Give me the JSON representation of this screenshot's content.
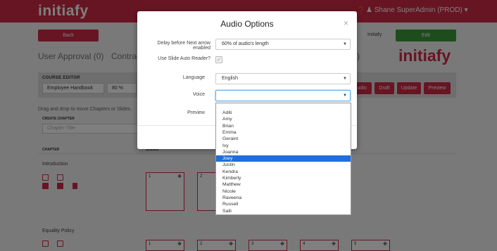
{
  "app": {
    "brand": "initiafy",
    "help_icon": "question-circle-icon",
    "user_label": "Shane SuperAdmin (PROD)",
    "user_icon": "user-icon",
    "back_label": "Back",
    "tab_user_approval": "User Approval (0)",
    "tab_contract": "Contrac",
    "tab_right": ")",
    "initiafy_link": "Initiafy",
    "edit_label": "Edit",
    "logo_text": "initiafy",
    "course_editor_label": "Course Editor",
    "course_select_value": "Employee Handbook",
    "zoom_value": "80 %",
    "btn_audio": "udio",
    "btn_draft": "Draft",
    "btn_update": "Update",
    "btn_preview": "Preview",
    "drag_text": "Drag and drop to move Chapters or Slides.",
    "create_chapter_label": "Create chapter",
    "chapter_placeholder": "Chapter Title",
    "col_chapter": "Chapter",
    "col_slides": "Slides",
    "chapters": [
      {
        "title": "Introduction"
      },
      {
        "title": "Equality Policy"
      }
    ],
    "slide_numbers_row1": [
      "1",
      "2"
    ],
    "slide_numbers_row2": [
      "1",
      "2",
      "3",
      "4",
      "5"
    ]
  },
  "modal": {
    "title": "Audio Options",
    "close_label": "×",
    "delay_label": "Delay before Next arrow enabled",
    "delay_value": "60% of audio's length",
    "auto_reader_label": "Use Slide Auto Reader?",
    "auto_reader_checked": "✓",
    "language_label": "Language",
    "language_value": "English",
    "voice_label": "Voice",
    "voice_value": "",
    "preview_label": "Preview"
  },
  "voice_options": [
    "Aditi",
    "Amy",
    "Brian",
    "Emma",
    "Geraint",
    "Ivy",
    "Joanna",
    "Joey",
    "Justin",
    "Kendra",
    "Kimberly",
    "Matthew",
    "Nicole",
    "Raveena",
    "Russell",
    "Salli"
  ],
  "voice_highlighted": "Joey",
  "colors": {
    "brand_red": "#cf2a46",
    "edit_green": "#3a9b3a",
    "highlight_blue": "#1e6fd9"
  }
}
